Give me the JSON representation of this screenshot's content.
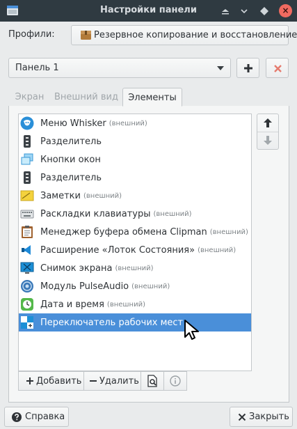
{
  "window": {
    "title": "Настройки панели",
    "close_glyph": "×",
    "minimize_glyph": "⌃",
    "maximize_glyph": "◇"
  },
  "profiles": {
    "label": "Профили:",
    "button_label": "Резервное копирование и восстановление"
  },
  "panel_selector": {
    "value": "Панель 1",
    "add_glyph": "+",
    "remove_glyph": "✖"
  },
  "tabs": [
    {
      "label": "Экран",
      "active": false
    },
    {
      "label": "Внешний вид",
      "active": false
    },
    {
      "label": "Элементы",
      "active": true
    }
  ],
  "items": [
    {
      "name": "Меню Whisker",
      "ext": "(внешний)",
      "icon": "whisker-menu-icon"
    },
    {
      "name": "Разделитель",
      "ext": "",
      "icon": "separator-icon"
    },
    {
      "name": "Кнопки окон",
      "ext": "",
      "icon": "window-buttons-icon"
    },
    {
      "name": "Разделитель",
      "ext": "",
      "icon": "separator-icon"
    },
    {
      "name": "Заметки",
      "ext": "(внешний)",
      "icon": "notes-icon"
    },
    {
      "name": "Раскладки клавиатуры",
      "ext": "(внешний)",
      "icon": "keyboard-icon"
    },
    {
      "name": "Менеджер буфера обмена Clipman",
      "ext": "(внешний)",
      "icon": "clipman-icon"
    },
    {
      "name": "Расширение «Лоток Состояния»",
      "ext": "(внешний)",
      "icon": "status-tray-icon"
    },
    {
      "name": "Снимок экрана",
      "ext": "(внешний)",
      "icon": "screenshot-icon"
    },
    {
      "name": "Модуль PulseAudio",
      "ext": "(внешний)",
      "icon": "pulseaudio-icon"
    },
    {
      "name": "Дата и время",
      "ext": "(внешний)",
      "icon": "datetime-icon"
    },
    {
      "name": "Переключатель рабочих мест",
      "ext": "",
      "icon": "workspace-switcher-icon",
      "selected": true
    }
  ],
  "list_toolbar": {
    "add_label": "Добавить",
    "remove_label": "Удалить"
  },
  "bottom": {
    "help_label": "Справка",
    "close_label": "Закрыть"
  },
  "colors": {
    "selection": "#4a8fd9",
    "titlebar": "#2f3a41",
    "close_button": "#f06a60"
  }
}
